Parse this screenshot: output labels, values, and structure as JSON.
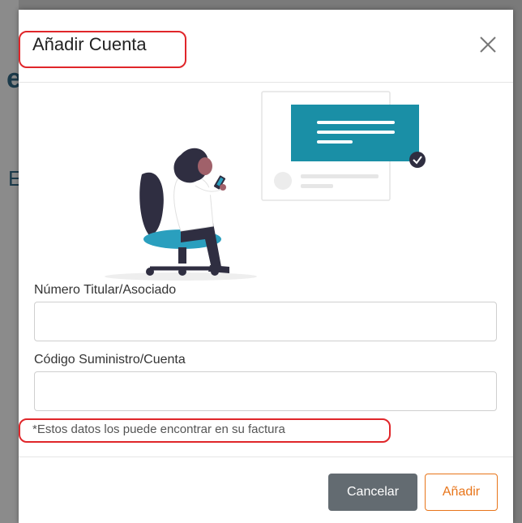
{
  "modal": {
    "title": "Añadir Cuenta",
    "close_icon": "close-icon",
    "fields": [
      {
        "label": "Número Titular/Asociado",
        "value": "",
        "placeholder": ""
      },
      {
        "label": "Código Suministro/Cuenta",
        "value": "",
        "placeholder": ""
      }
    ],
    "hint": "*Estos datos los puede encontrar en su factura",
    "buttons": {
      "cancel": "Cancelar",
      "add": "Añadir"
    }
  },
  "background": {
    "glyph_e": "e",
    "glyph_E": "E"
  },
  "colors": {
    "accent_teal": "#1a8fa6",
    "add_orange": "#e8751a",
    "cancel_gray": "#636b71",
    "highlight_red": "#e0262a",
    "chair_blue": "#2a9fbe"
  }
}
